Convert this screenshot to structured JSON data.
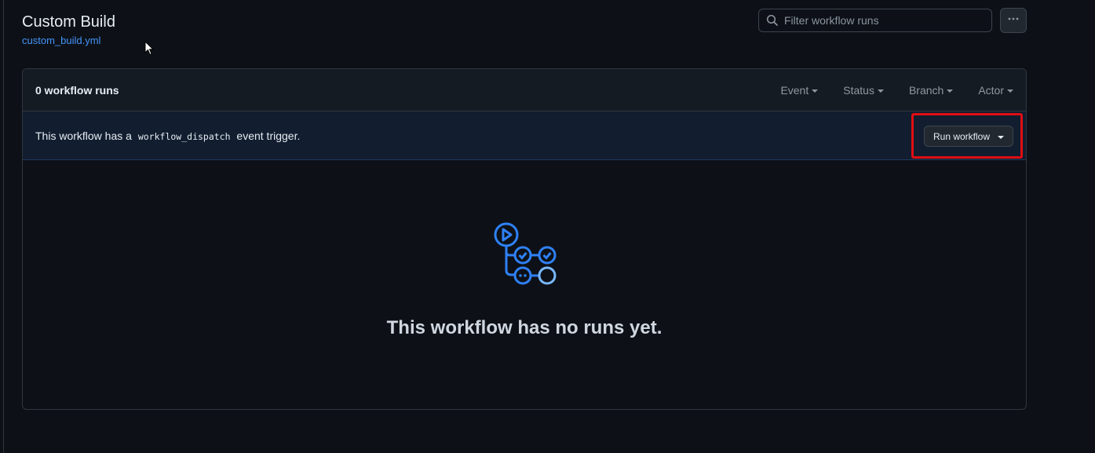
{
  "header": {
    "title": "Custom Build",
    "file_link": "custom_build.yml"
  },
  "search": {
    "placeholder": "Filter workflow runs",
    "value": ""
  },
  "panel": {
    "run_count": "0 workflow runs",
    "filters": [
      "Event",
      "Status",
      "Branch",
      "Actor"
    ],
    "dispatch": {
      "prefix": "This workflow has a",
      "code": "workflow_dispatch",
      "suffix": "event trigger.",
      "button_label": "Run workflow"
    },
    "empty_state": {
      "message": "This workflow has no runs yet.",
      "icon": "workflow-graph-icon"
    }
  },
  "colors": {
    "background": "#0d1117",
    "link": "#4493f8",
    "highlight": "#e00d14",
    "dispatch_bg": "#121d2f"
  },
  "icons": [
    "search-icon",
    "kebab-horizontal-icon",
    "chevron-down-icon",
    "workflow-graph-icon",
    "cursor-icon"
  ]
}
